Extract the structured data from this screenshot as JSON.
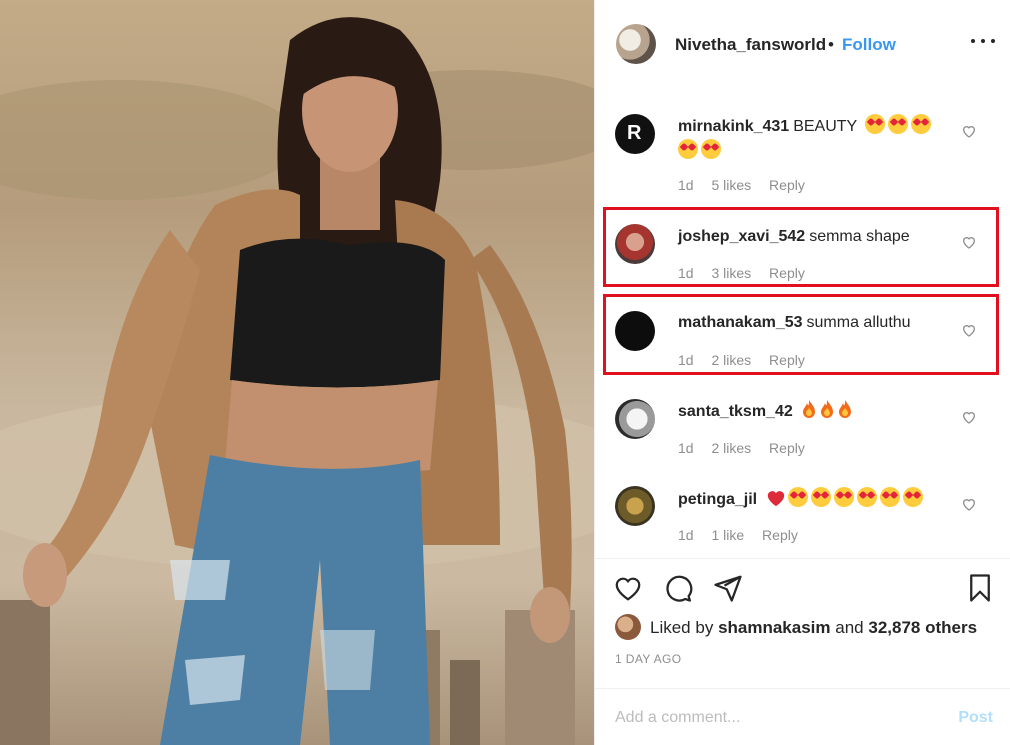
{
  "post": {
    "author": "Nivetha_fansworld",
    "separator": "•",
    "follow_label": "Follow",
    "more_icon": "more-options-icon"
  },
  "comments": [
    {
      "user": "mirnakink_431",
      "text": "BEAUTY",
      "emoji": "heart-eyes x5",
      "age": "1d",
      "likes": "5 likes",
      "reply": "Reply",
      "highlighted": false
    },
    {
      "user": "joshep_xavi_542",
      "text": "semma shape",
      "age": "1d",
      "likes": "3 likes",
      "reply": "Reply",
      "highlighted": true
    },
    {
      "user": "mathanakam_53",
      "text": "summa alluthu",
      "age": "1d",
      "likes": "2 likes",
      "reply": "Reply",
      "highlighted": true
    },
    {
      "user": "santa_tksm_42",
      "text": "",
      "emoji": "fire x3",
      "age": "1d",
      "likes": "2 likes",
      "reply": "Reply",
      "highlighted": false
    },
    {
      "user": "petinga_jil",
      "text": "",
      "emoji": "red-heart, heart-eyes x6",
      "age": "1d",
      "likes": "1 like",
      "reply": "Reply",
      "highlighted": false
    }
  ],
  "actions": [
    "heart-icon",
    "comment-icon",
    "share-icon",
    "bookmark-icon"
  ],
  "likes": {
    "prefix": "Liked by",
    "user": "shamnakasim",
    "middle": "and",
    "others": "32,878 others"
  },
  "timestamp": "1 DAY AGO",
  "add_comment": {
    "placeholder": "Add a comment...",
    "post_label": "Post"
  },
  "colors": {
    "accent": "#3897f0",
    "highlight_box": "#e0101e",
    "muted_text": "#8e8e8e"
  }
}
